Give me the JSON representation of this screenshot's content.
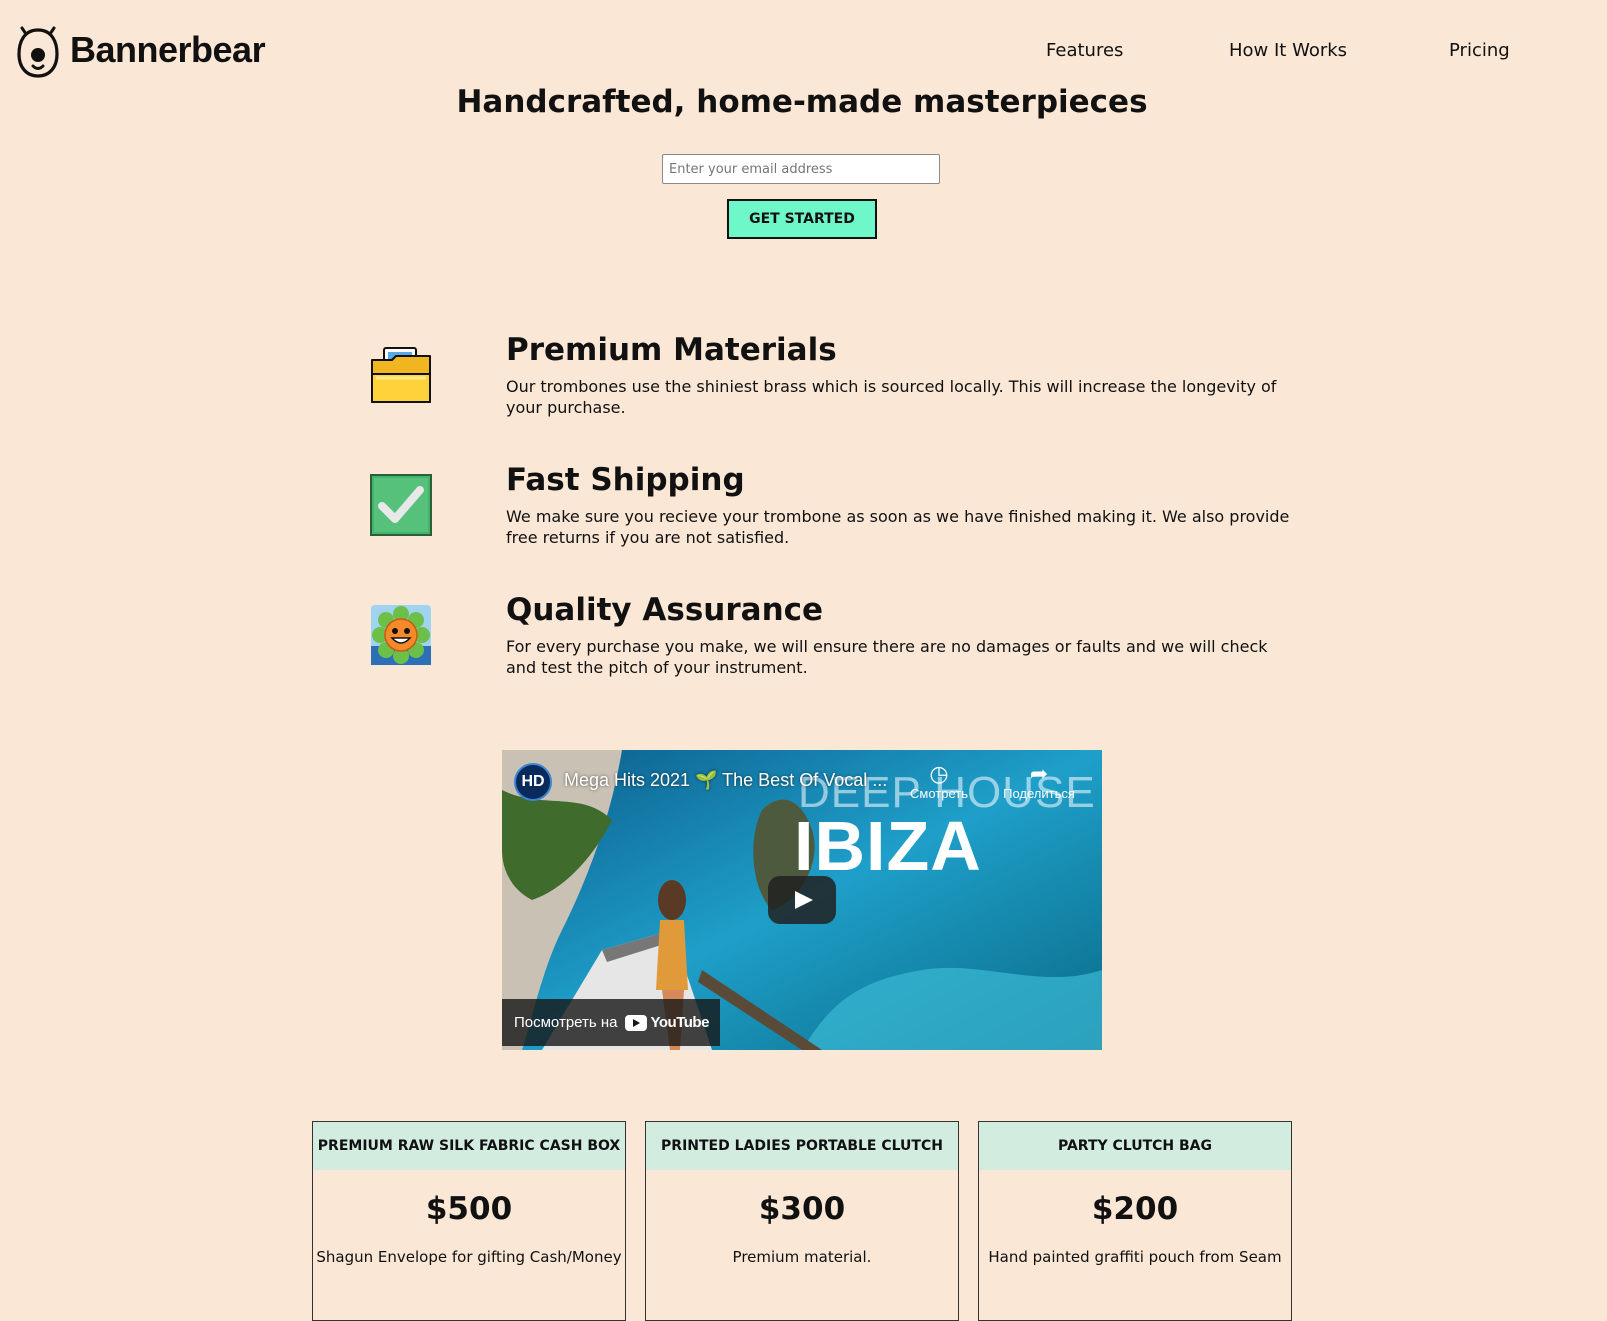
{
  "header": {
    "brand": "Bannerbear",
    "nav": [
      "Features",
      "How It Works",
      "Pricing"
    ]
  },
  "hero": {
    "title": "Handcrafted, home-made masterpieces",
    "email_placeholder": "Enter your email address",
    "cta_label": "GET STARTED"
  },
  "features": [
    {
      "icon": "folder-icon",
      "title": "Premium Materials",
      "text": "Our trombones use the shiniest brass which is sourced locally. This will increase the longevity of your purchase."
    },
    {
      "icon": "checkmark-icon",
      "title": "Fast Shipping",
      "text": "We make sure you recieve your trombone as soon as we have finished making it. We also provide free returns if you are not satisfied."
    },
    {
      "icon": "smiling-flower-icon",
      "title": "Quality Assurance",
      "text": "For every purchase you make, we will ensure there are no damages or faults and we will check and test the pitch of your instrument."
    }
  ],
  "video": {
    "channel_badge": "HD",
    "title": "Mega Hits 2021 🌱 The Best Of Vocal ...",
    "thumbnail_text_1": "DEEP HOUSE",
    "thumbnail_text_2": "IBIZA",
    "watch_later_label": "Смотреть",
    "share_label": "Поделиться",
    "watch_on_label": "Посмотреть на",
    "youtube_label": "YouTube"
  },
  "pricing": [
    {
      "name": "PREMIUM RAW SILK FABRIC CASH BOX",
      "price": "$500",
      "description": "Shagun Envelope for gifting Cash/Money"
    },
    {
      "name": "PRINTED LADIES PORTABLE CLUTCH",
      "price": "$300",
      "description": "Premium material."
    },
    {
      "name": "PARTY CLUTCH BAG",
      "price": "$200",
      "description": "Hand painted graffiti pouch from Seam"
    }
  ],
  "colors": {
    "background": "#fae7d5",
    "cta": "#6ef7c8",
    "card_header": "#d2ece0"
  }
}
